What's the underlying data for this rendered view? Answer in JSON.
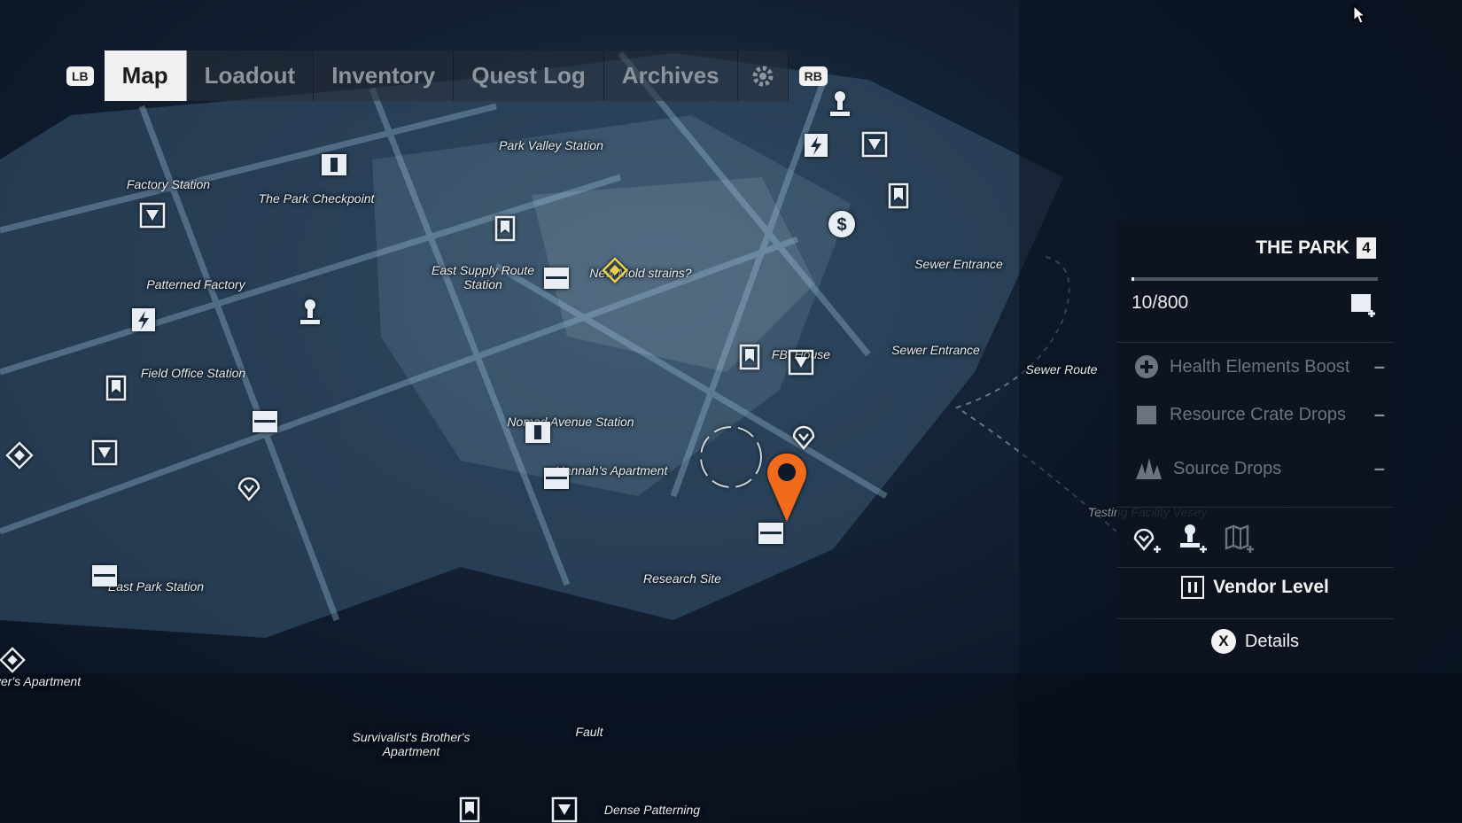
{
  "nav": {
    "lb": "LB",
    "rb": "RB",
    "tabs": [
      {
        "label": "Map",
        "active": true
      },
      {
        "label": "Loadout",
        "active": false
      },
      {
        "label": "Inventory",
        "active": false
      },
      {
        "label": "Quest Log",
        "active": false
      },
      {
        "label": "Archives",
        "active": false
      }
    ],
    "settings_icon": "gear-icon"
  },
  "map": {
    "locations": [
      "Park Valley Station",
      "Factory Station",
      "The Park Checkpoint",
      "Patterned Factory",
      "East Supply Route Station",
      "New Mold strains?",
      "Sewer Entrance",
      "Sewer Entrance",
      "Sewer Route",
      "FBI House",
      "Field Office Station",
      "Nomad Avenue Station",
      "Hannah's Apartment",
      "Research Site",
      "East Park Station",
      "Testing Facility Vesey",
      "Buyer's Apartment",
      "Survivalist's Brother's Apartment",
      "Fault",
      "Dense Patterning"
    ]
  },
  "panel": {
    "region": "THE PARK",
    "tier": "4",
    "progress_text": "10/800",
    "progress_fraction": 0.0125,
    "boosts": [
      {
        "label": "Health Elements Boost",
        "icon": "health-plus-icon",
        "value": "–"
      },
      {
        "label": "Resource Crate Drops",
        "icon": "crate-icon",
        "value": "–"
      },
      {
        "label": "Source Drops",
        "icon": "source-icon",
        "value": "–"
      }
    ],
    "vendor_label": "Vendor Level",
    "details_button": "X",
    "details_label": "Details"
  },
  "colors": {
    "accent_marker": "#f26a1b",
    "objective": "#e8d04a"
  }
}
